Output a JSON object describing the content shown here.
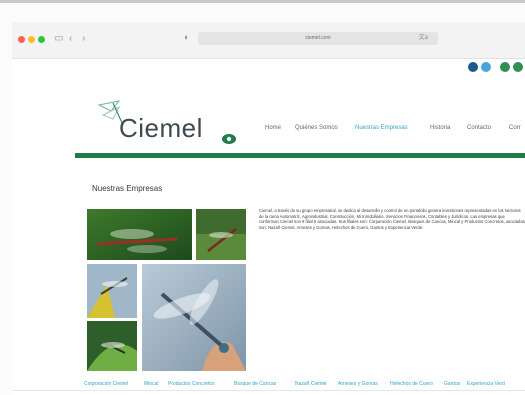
{
  "browser": {
    "url": "ciemel.com",
    "icons": [
      "sidebar-icon",
      "back-icon",
      "forward-icon",
      "shield-icon",
      "translate-icon"
    ]
  },
  "site": {
    "logo_text": "Ciemel",
    "nav": [
      "Home",
      "Quiénes Somos",
      "Nuestras Empresas",
      "Historia",
      "Contacto",
      "Corr"
    ],
    "active_nav": "Nuestras Empresas",
    "accent_color": "#1f7b47",
    "link_color": "#35a3c7"
  },
  "main": {
    "heading": "Nuestras Empresas",
    "description": "Ciemel, a través de su grupo empresarial, se dedica al desarrollo y control de un portafolio genera inversiones representadas en los sectores de la rama Automotriz, Agroindustrial, Construcción, Mi Inmobiliario, Servicios Financieros, Contables y Jurídicos. Las empresas que conforman Ciemel son 9 filial 5 asociadas. Sus filiales son: Corporación Ciemel, Bosques de Cancas, Mincal y Productos Concretos, asociadas son: Nazañ Ciemel, Arneses y Gomas, Helechos de Cuero, Gantos y Experiencia Verde."
  },
  "footer": {
    "links": [
      "Corporación Ciemel",
      "Mincal",
      "Productos Concretos",
      "Bosque de Cancas",
      "Nazañ Ciemel",
      "Arneses y Gomas",
      "Helechos de Cuero",
      "Gantos",
      "Experiencia Verd"
    ]
  }
}
